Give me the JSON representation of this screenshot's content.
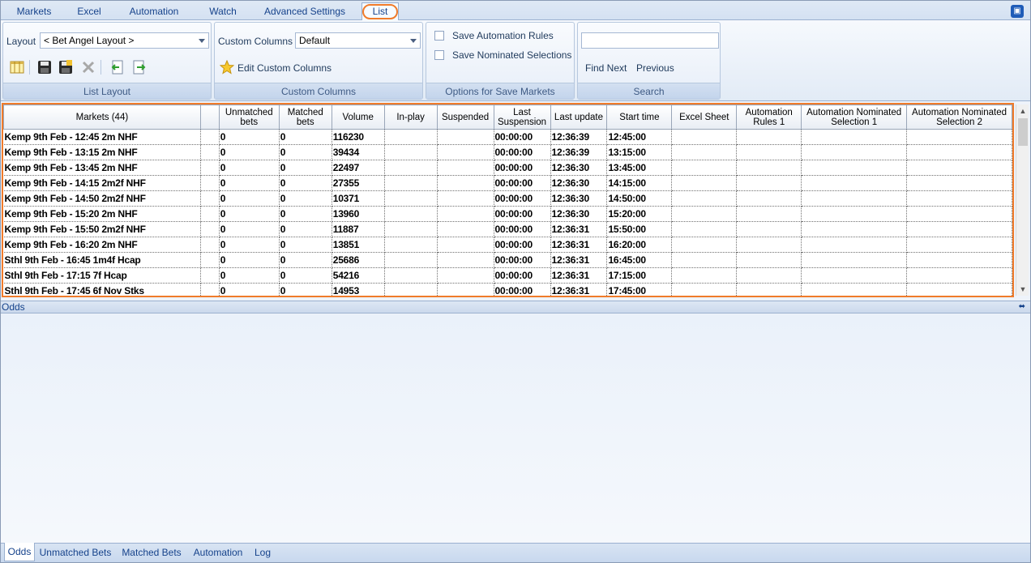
{
  "tabs": [
    {
      "label": "Markets",
      "active": false
    },
    {
      "label": "Excel",
      "active": false
    },
    {
      "label": "Automation",
      "active": false
    },
    {
      "label": "Watch",
      "active": false
    },
    {
      "label": "Advanced Settings",
      "active": false
    },
    {
      "label": "List",
      "active": true
    }
  ],
  "ribbon": {
    "list_layout": {
      "layout_label": "Layout",
      "layout_value": "< Bet Angel Layout >",
      "title": "List Layout"
    },
    "custom_columns": {
      "label": "Custom Columns",
      "value": "Default",
      "edit_label": "Edit Custom Columns",
      "title": "Custom Columns"
    },
    "save_markets": {
      "save_rules_label": "Save Automation Rules",
      "save_nominated_label": "Save Nominated Selections",
      "title": "Options for Save Markets"
    },
    "search": {
      "value": "",
      "find_next_label": "Find Next",
      "previous_label": "Previous",
      "title": "Search"
    }
  },
  "grid": {
    "columns": [
      "Markets (44)",
      "",
      "Unmatched bets",
      "Matched bets",
      "Volume",
      "In-play",
      "Suspended",
      "Last Suspension",
      "Last update",
      "Start time",
      "Excel Sheet",
      "Automation Rules 1",
      "Automation Nominated Selection 1",
      "Automation Nominated Selection 2"
    ],
    "rows": [
      [
        "Kemp 9th Feb - 12:45 2m NHF",
        "",
        "0",
        "0",
        "116230",
        "",
        "",
        "00:00:00",
        "12:36:39",
        "12:45:00",
        "",
        "",
        "",
        ""
      ],
      [
        "Kemp 9th Feb - 13:15 2m NHF",
        "",
        "0",
        "0",
        "39434",
        "",
        "",
        "00:00:00",
        "12:36:39",
        "13:15:00",
        "",
        "",
        "",
        ""
      ],
      [
        "Kemp 9th Feb - 13:45 2m NHF",
        "",
        "0",
        "0",
        "22497",
        "",
        "",
        "00:00:00",
        "12:36:30",
        "13:45:00",
        "",
        "",
        "",
        ""
      ],
      [
        "Kemp 9th Feb - 14:15 2m2f NHF",
        "",
        "0",
        "0",
        "27355",
        "",
        "",
        "00:00:00",
        "12:36:30",
        "14:15:00",
        "",
        "",
        "",
        ""
      ],
      [
        "Kemp 9th Feb - 14:50 2m2f NHF",
        "",
        "0",
        "0",
        "10371",
        "",
        "",
        "00:00:00",
        "12:36:30",
        "14:50:00",
        "",
        "",
        "",
        ""
      ],
      [
        "Kemp 9th Feb - 15:20 2m NHF",
        "",
        "0",
        "0",
        "13960",
        "",
        "",
        "00:00:00",
        "12:36:30",
        "15:20:00",
        "",
        "",
        "",
        ""
      ],
      [
        "Kemp 9th Feb - 15:50 2m2f NHF",
        "",
        "0",
        "0",
        "11887",
        "",
        "",
        "00:00:00",
        "12:36:31",
        "15:50:00",
        "",
        "",
        "",
        ""
      ],
      [
        "Kemp 9th Feb - 16:20 2m NHF",
        "",
        "0",
        "0",
        "13851",
        "",
        "",
        "00:00:00",
        "12:36:31",
        "16:20:00",
        "",
        "",
        "",
        ""
      ],
      [
        "Sthl 9th Feb - 16:45 1m4f Hcap",
        "",
        "0",
        "0",
        "25686",
        "",
        "",
        "00:00:00",
        "12:36:31",
        "16:45:00",
        "",
        "",
        "",
        ""
      ],
      [
        "Sthl 9th Feb - 17:15 7f Hcap",
        "",
        "0",
        "0",
        "54216",
        "",
        "",
        "00:00:00",
        "12:36:31",
        "17:15:00",
        "",
        "",
        "",
        ""
      ],
      [
        "Sthl 9th Feb - 17:45 6f Nov Stks",
        "",
        "0",
        "0",
        "14953",
        "",
        "",
        "00:00:00",
        "12:36:31",
        "17:45:00",
        "",
        "",
        "",
        ""
      ]
    ]
  },
  "odds_pane": {
    "title": "Odds"
  },
  "bottom_tabs": [
    {
      "label": "Odds",
      "active": true
    },
    {
      "label": "Unmatched Bets",
      "active": false
    },
    {
      "label": "Matched Bets",
      "active": false
    },
    {
      "label": "Automation",
      "active": false
    },
    {
      "label": "Log",
      "active": false
    }
  ],
  "colors": {
    "accent": "#f07b2a",
    "ribbon_text": "#15428b"
  }
}
